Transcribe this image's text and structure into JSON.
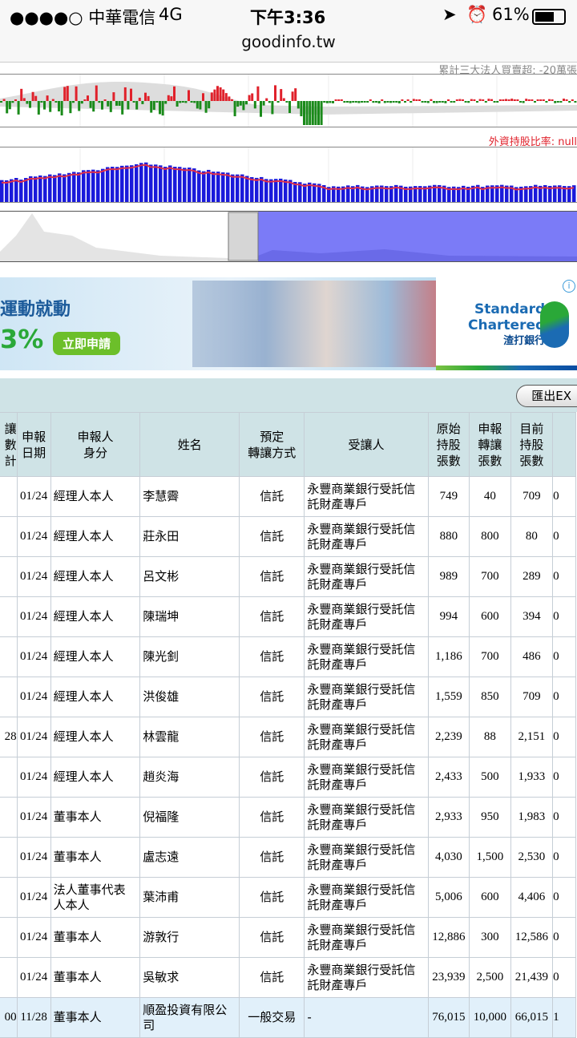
{
  "status_bar": {
    "carrier": "●●●●○ 中華電信",
    "network": "4G",
    "time": "下午3:36",
    "battery": "61%",
    "url": "goodinfo.tw"
  },
  "charts": {
    "institutional_label": "累計三大法人買賣超: -20萬張",
    "foreign_label": "外資持股比率: null"
  },
  "ad": {
    "headline": "運動就動",
    "rate": "3%",
    "apply_button": "立即申請",
    "brand_en_1": "Standard",
    "brand_en_2": "Chartered",
    "brand_zh": "渣打銀行",
    "info_icon": "i"
  },
  "toolbar": {
    "export_button": "匯出EX"
  },
  "table": {
    "headers": [
      "讓\n數\n計",
      "申報\n日期",
      "申報人\n身分",
      "姓名",
      "預定\n轉讓方式",
      "受讓人",
      "原始\n持股\n張數",
      "申報\n轉讓\n張數",
      "目前\n持股\n張數",
      ""
    ],
    "rows": [
      [
        "",
        "01/24",
        "經理人本人",
        "李慧霽",
        "信託",
        "永豐商業銀行受託信託財產專戶",
        "749",
        "40",
        "709",
        "0"
      ],
      [
        "",
        "01/24",
        "經理人本人",
        "莊永田",
        "信託",
        "永豐商業銀行受託信託財產專戶",
        "880",
        "800",
        "80",
        "0"
      ],
      [
        "",
        "01/24",
        "經理人本人",
        "呂文彬",
        "信託",
        "永豐商業銀行受託信託財產專戶",
        "989",
        "700",
        "289",
        "0"
      ],
      [
        "",
        "01/24",
        "經理人本人",
        "陳瑞坤",
        "信託",
        "永豐商業銀行受託信託財產專戶",
        "994",
        "600",
        "394",
        "0"
      ],
      [
        "",
        "01/24",
        "經理人本人",
        "陳光釗",
        "信託",
        "永豐商業銀行受託信託財產專戶",
        "1,186",
        "700",
        "486",
        "0"
      ],
      [
        "",
        "01/24",
        "經理人本人",
        "洪俊雄",
        "信託",
        "永豐商業銀行受託信託財產專戶",
        "1,559",
        "850",
        "709",
        "0"
      ],
      [
        "28",
        "01/24",
        "經理人本人",
        "林雲龍",
        "信託",
        "永豐商業銀行受託信託財產專戶",
        "2,239",
        "88",
        "2,151",
        "0"
      ],
      [
        "",
        "01/24",
        "經理人本人",
        "趙炎海",
        "信託",
        "永豐商業銀行受託信託財產專戶",
        "2,433",
        "500",
        "1,933",
        "0"
      ],
      [
        "",
        "01/24",
        "董事本人",
        "倪福隆",
        "信託",
        "永豐商業銀行受託信託財產專戶",
        "2,933",
        "950",
        "1,983",
        "0"
      ],
      [
        "",
        "01/24",
        "董事本人",
        "盧志遠",
        "信託",
        "永豐商業銀行受託信託財產專戶",
        "4,030",
        "1,500",
        "2,530",
        "0"
      ],
      [
        "",
        "01/24",
        "法人董事代表人本人",
        "葉沛甫",
        "信託",
        "永豐商業銀行受託信託財產專戶",
        "5,006",
        "600",
        "4,406",
        "0"
      ],
      [
        "",
        "01/24",
        "董事本人",
        "游敦行",
        "信託",
        "永豐商業銀行受託信託財產專戶",
        "12,886",
        "300",
        "12,586",
        "0"
      ],
      [
        "",
        "01/24",
        "董事本人",
        "吳敏求",
        "信託",
        "永豐商業銀行受託信託財產專戶",
        "23,939",
        "2,500",
        "21,439",
        "0"
      ],
      [
        "00",
        "11/28",
        "董事本人",
        "順盈投資有限公司",
        "一般交易",
        "-",
        "76,015",
        "10,000",
        "66,015",
        "1"
      ]
    ]
  },
  "colors": {
    "up": "#e0212b",
    "down": "#1a8a1a",
    "bar": "#1a1adb",
    "ratio_line": "#e0304a",
    "navigator": "#7b7bf7",
    "header_bg": "#cfe3e6"
  }
}
